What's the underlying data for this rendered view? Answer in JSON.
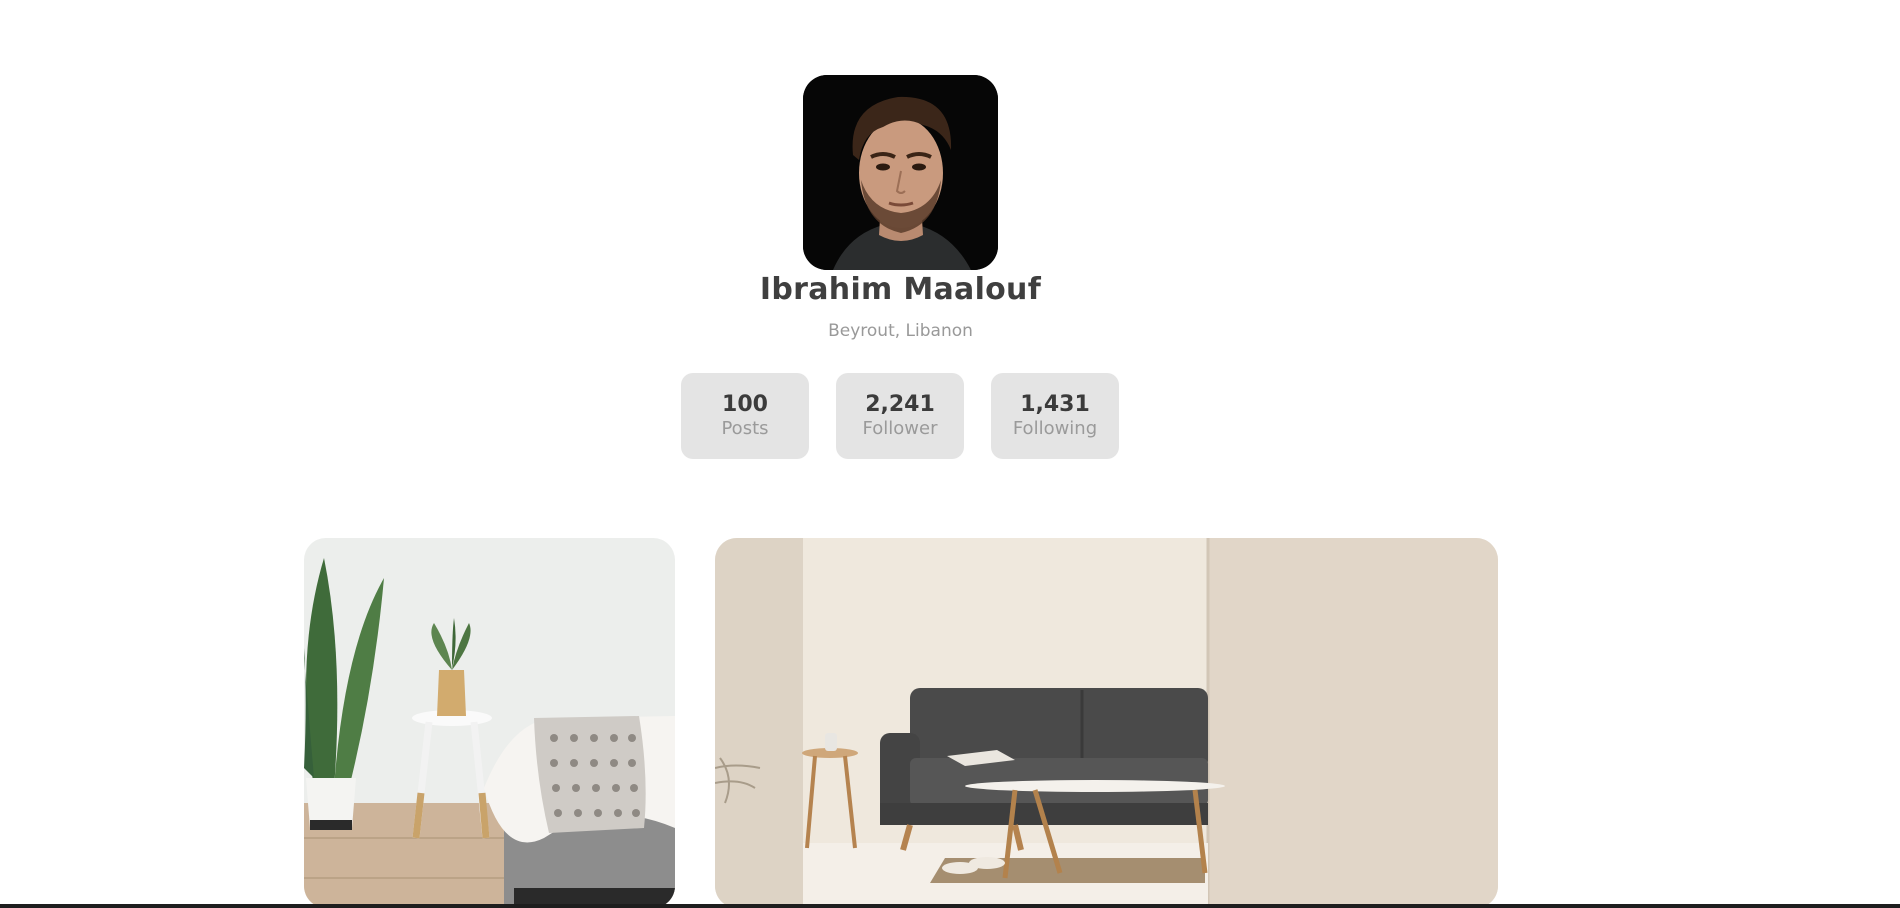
{
  "profile": {
    "name": "Ibrahim Maalouf",
    "location": "Beyrout, Libanon",
    "avatar_icon": "avatar-portrait"
  },
  "stats": [
    {
      "value": "100",
      "label": "Posts"
    },
    {
      "value": "2,241",
      "label": "Follower"
    },
    {
      "value": "1,431",
      "label": "Following"
    }
  ],
  "gallery": [
    {
      "subject": "plant-and-side-table-bedroom"
    },
    {
      "subject": "dark-sofa-living-room"
    }
  ],
  "colors": {
    "name": "#3f3f3f",
    "muted": "#999999",
    "stat_bg": "#e4e4e4",
    "background": "#ffffff"
  }
}
